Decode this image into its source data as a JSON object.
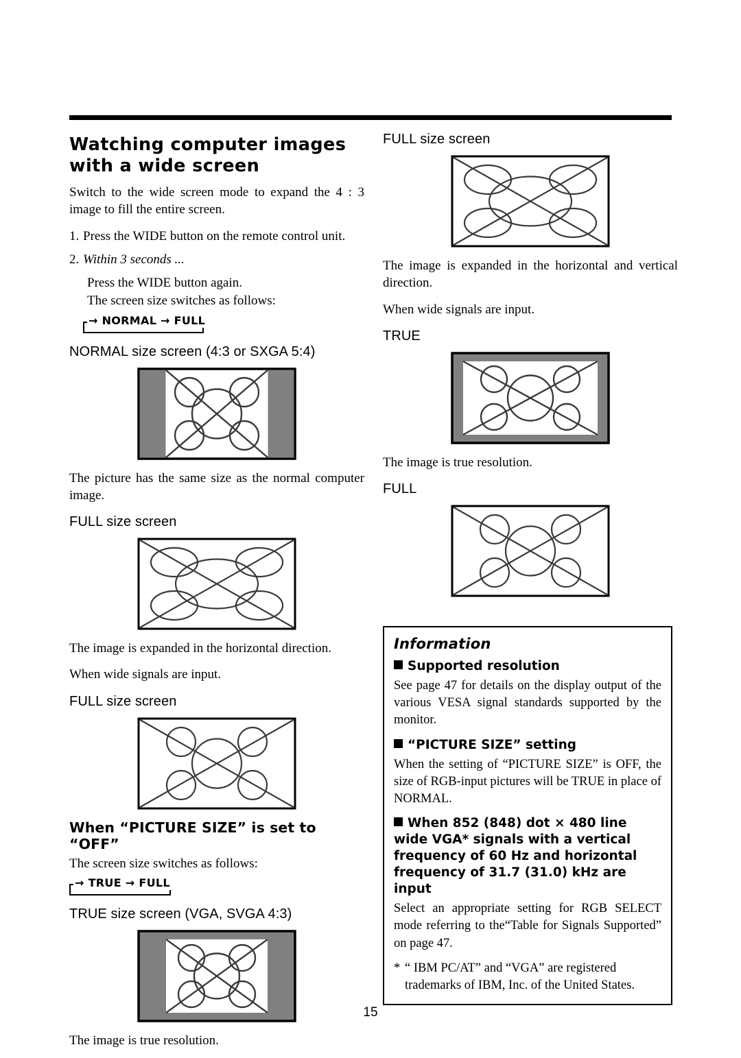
{
  "page": {
    "number": "15",
    "colors": {
      "ink": "#000000",
      "paper": "#ffffff",
      "mask_gray": "#808080",
      "figure_line": "#3a3a3a"
    }
  },
  "left_column": {
    "title": "Watching computer images with a wide screen",
    "intro": "Switch to the wide screen mode to expand the 4 : 3 image to fill the entire screen.",
    "steps": [
      {
        "num": "1.",
        "text": "Press the WIDE button on the remote control unit.",
        "italic": false
      },
      {
        "num": "2.",
        "text": "Within 3 seconds ...",
        "italic": true
      }
    ],
    "sub_lines": [
      "Press the WIDE button again.",
      "The screen size switches as follows:"
    ],
    "cycle_normal": "→ NORMAL → FULL",
    "normal_label": "NORMAL size screen (4:3 or SXGA 5:4)",
    "normal_caption": "The picture has the same size as the normal computer image.",
    "full_label_1": "FULL size screen",
    "full_caption_1": "The image is expanded in the horizontal direction.",
    "wide_note": "When wide signals are input.",
    "full_label_2": "FULL size screen",
    "picture_size_heading": "When “PICTURE SIZE” is set to “OFF”",
    "picture_size_sub": "The screen size switches as follows:",
    "cycle_true": "→ TRUE → FULL",
    "true_label": "TRUE size screen (VGA, SVGA 4:3)",
    "true_caption": "The image is true resolution."
  },
  "right_column": {
    "full_label_1": "FULL size screen",
    "full_caption_1": "The image is expanded in the horizontal and vertical direction.",
    "wide_note": "When wide signals are input.",
    "true_label": "TRUE",
    "true_caption": "The image is true resolution.",
    "full_label_2": "FULL"
  },
  "information": {
    "title": "Information",
    "sections": [
      {
        "heading": "Supported resolution",
        "body": "See page 47 for details on the display output of the various VESA signal standards supported by the monitor."
      },
      {
        "heading": "“PICTURE SIZE” setting",
        "body": "When the setting of “PICTURE SIZE” is OFF, the size of RGB-input pictures will be TRUE in place of NORMAL."
      },
      {
        "heading": "When 852 (848) dot × 480 line wide VGA* signals with a vertical frequency of 60 Hz and horizontal frequency of 31.7 (31.0) kHz are input",
        "body": "Select an appropriate setting for RGB SELECT mode referring to the“Table for Signals Supported” on page 47."
      }
    ],
    "footnote_marker": "*",
    "footnote": "“ IBM PC/AT” and “VGA” are registered trademarks of IBM, Inc. of the United States."
  },
  "figures": {
    "normal_4x3": {
      "type": "side-masked",
      "mask": "both-sides",
      "shape": "circles"
    },
    "full_stretched_left": {
      "type": "fullbleed",
      "shape": "ellipses"
    },
    "full_wide_left": {
      "type": "fullbleed",
      "shape": "circles"
    },
    "true_boxed_left": {
      "type": "all-masked",
      "shape": "circles"
    },
    "full_stretched_right": {
      "type": "fullbleed",
      "shape": "ellipses"
    },
    "true_thin_right": {
      "type": "thin-masked",
      "shape": "circles"
    },
    "full_right": {
      "type": "fullbleed",
      "shape": "circles"
    }
  }
}
